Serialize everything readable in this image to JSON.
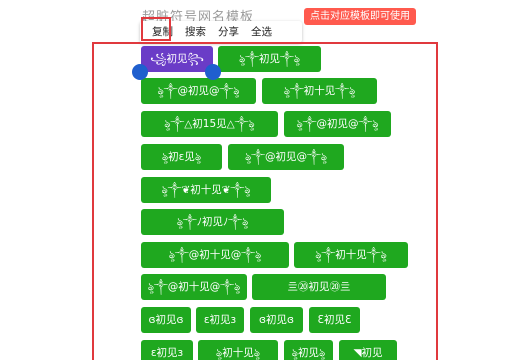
{
  "header": {
    "title": "超脏符号网名模板",
    "hint": "点击对应模板即可使用"
  },
  "context_menu": {
    "items": [
      "复制",
      "搜索",
      "分享",
      "全选"
    ]
  },
  "tags": [
    "꧁初见꧂",
    "ৡ༒初见༒ৡ",
    "ৡ༒@初见@༒ৡ",
    "ৡ༒初十见༒ৡ",
    "ৡ༒△初15见△༒ৡ",
    "ৡ༒@初见@༒ৡ",
    "ৡ初ɛ见ৡ",
    "ৡ༒@初见@༒ৡ",
    "ৡ༒❦初十见❦༒ৡ",
    "ৡ༒ﾉ初见ﾉ༒ৡ",
    "ৡ༒@初十见@༒ৡ",
    "ৡ༒初十见༒ৡ",
    "ৡ༒@初十见@༒ৡ",
    "亖⑳初见⑳亖",
    "ɞ初见ɞ",
    "ɛ初见ɜ",
    "ɞ初见ɞ",
    "Ɛ初见Ɛ",
    "ɛ初见ɜ",
    "ৡ初十见ৡ",
    "ৡ初见ৡ",
    "◥初见"
  ]
}
